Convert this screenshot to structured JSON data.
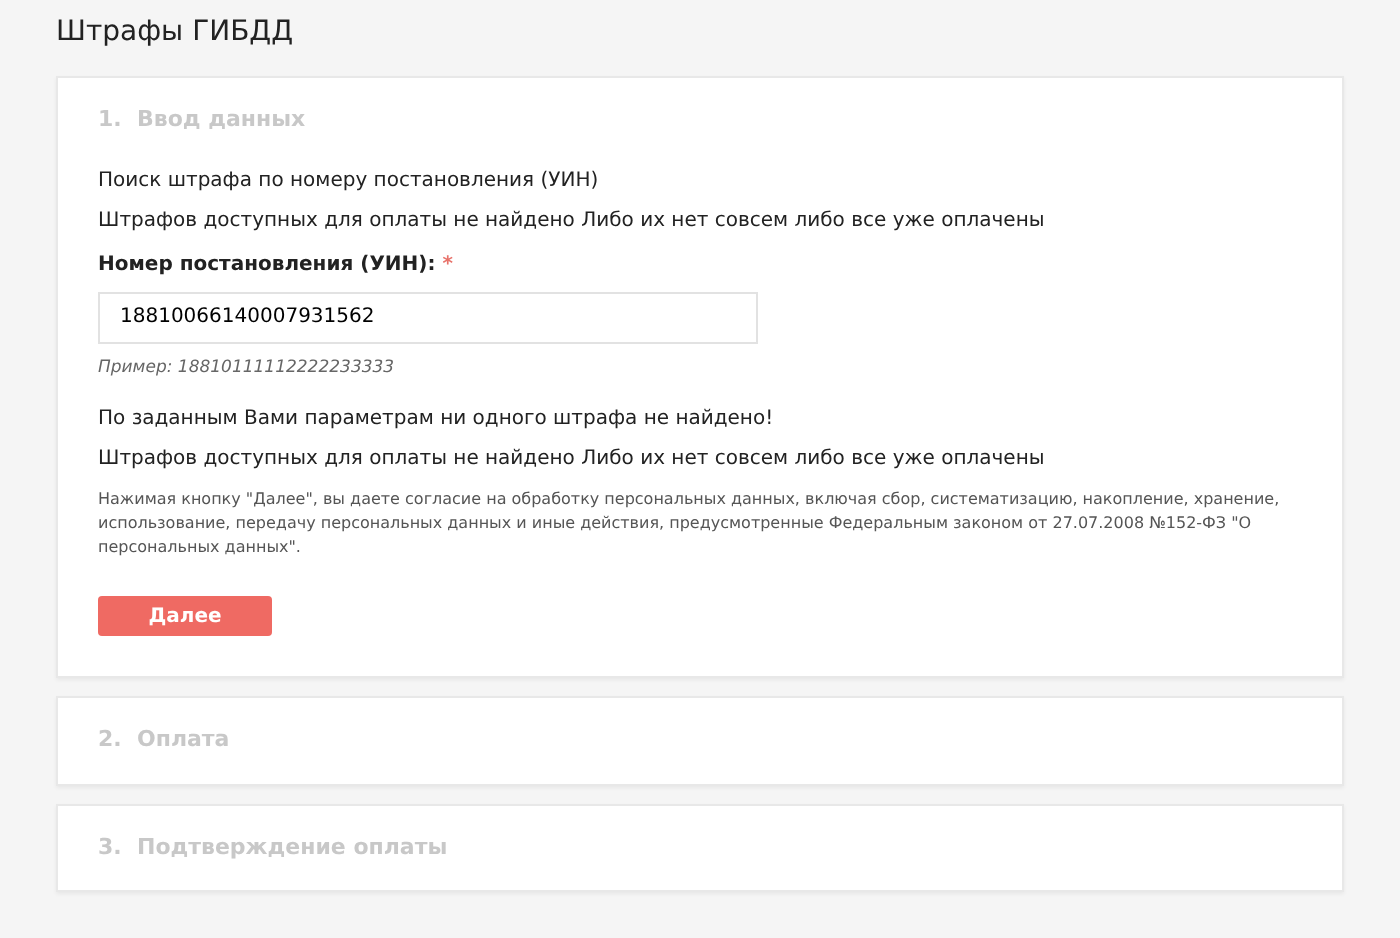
{
  "page_title": "Штрафы ГИБДД",
  "steps": [
    {
      "number": "1.",
      "title": "Ввод данных",
      "expanded": true
    },
    {
      "number": "2.",
      "title": "Оплата",
      "expanded": false
    },
    {
      "number": "3.",
      "title": "Подтверждение оплаты",
      "expanded": false
    }
  ],
  "form": {
    "intro": [
      "Поиск штрафа по номеру постановления (УИН)",
      "Штрафов доступных для оплаты не найдено Либо их нет совсем либо все уже оплачены"
    ],
    "field_label": "Номер постановления (УИН):",
    "required_mark": "*",
    "value": "18810066140007931562",
    "hint": "Пример: 18810111112222233333",
    "messages": [
      "По заданным Вами параметрам ни одного штрафа не найдено!",
      "Штрафов доступных для оплаты не найдено Либо их нет совсем либо все уже оплачены"
    ],
    "consent": "Нажимая кнопку \"Далее\", вы даете согласие на обработку персональных данных, включая сбор, систематизацию, накопление, хранение, использование, передачу персональных данных и иные действия, предусмотренные Федеральным законом от 27.07.2008 №152-ФЗ \"О персональных данных\".",
    "button": "Далее"
  }
}
